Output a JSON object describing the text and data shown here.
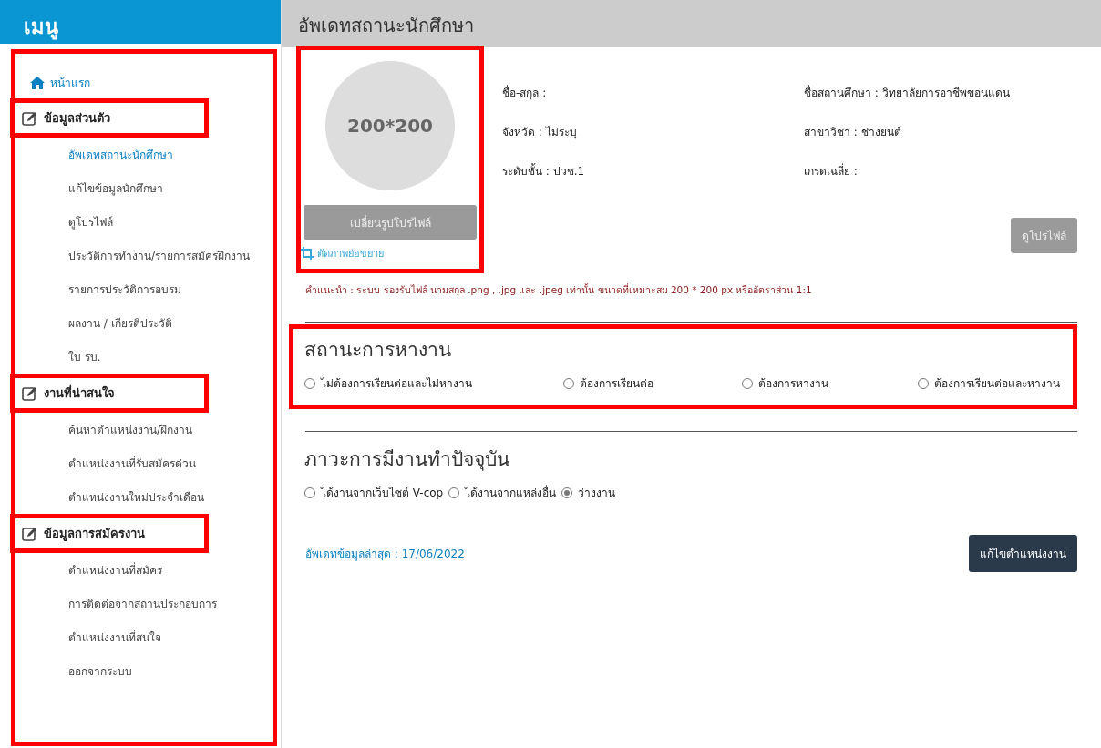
{
  "sidebar": {
    "title": "เมนู",
    "highlighted": true,
    "home": {
      "label": "หน้าแรก"
    },
    "sections": [
      {
        "heading": "ข้อมูลส่วนตัว",
        "highlighted": true,
        "items": [
          {
            "label": "อัพเดทสถานะนักศึกษา",
            "selected": true
          },
          {
            "label": "แก้ไขข้อมูลนักศึกษา",
            "selected": false
          },
          {
            "label": "ดูโปรไฟล์",
            "selected": false
          },
          {
            "label": "ประวัติการทำงาน/รายการสมัครฝึกงาน",
            "selected": false
          },
          {
            "label": "รายการประวัติการอบรม",
            "selected": false
          },
          {
            "label": "ผลงาน / เกียรติประวัติ",
            "selected": false
          },
          {
            "label": "ใบ รบ.",
            "selected": false
          }
        ]
      },
      {
        "heading": "งานที่น่าสนใจ",
        "highlighted": true,
        "items": [
          {
            "label": "ค้นหาตำแหน่งงาน/ฝึกงาน",
            "selected": false
          },
          {
            "label": "ตำแหน่งงานที่รับสมัครด่วน",
            "selected": false
          },
          {
            "label": "ตำแหน่งงานใหม่ประจำเดือน",
            "selected": false
          }
        ]
      },
      {
        "heading": "ข้อมูลการสมัครงาน",
        "highlighted": true,
        "items": [
          {
            "label": "ตำแหน่งงานที่สมัคร",
            "selected": false
          },
          {
            "label": "การติดต่อจากสถานประกอบการ",
            "selected": false
          },
          {
            "label": "ตำแหน่งงานที่สนใจ",
            "selected": false
          },
          {
            "label": "ออกจากระบบ",
            "selected": false
          }
        ]
      }
    ]
  },
  "page": {
    "title": "อัพเดทสถานะนักศึกษา"
  },
  "profile": {
    "highlighted": true,
    "photo_placeholder": "200*200",
    "change_photo_button": "เปลี่ยนรูปโปรไฟล์",
    "crop_link": "ตัดภาพย่อขยาย",
    "fields": [
      {
        "label": "ชื่อ-สกุล :"
      },
      {
        "label": "ชื่อสถานศึกษา :",
        "value": "วิทยาลัยการอาชีพขอนแดน"
      },
      {
        "label": "จังหวัด :",
        "value": "ไม่ระบุ"
      },
      {
        "label": "สาขาวิชา :",
        "value": "ช่างยนต์"
      },
      {
        "label": "ระดับชั้น :",
        "value": "ปวช.1"
      },
      {
        "label": "เกรดเฉลี่ย :"
      }
    ],
    "view_profile_button": "ดูโปรไฟล์",
    "hint": "คำแนะนำ : ระบบ รองรับไฟล์ นามสกุล .png , .jpg และ .jpeg เท่านั้น ขนาดที่เหมาะสม 200 * 200 px หรืออัตราส่วน 1:1"
  },
  "job_search_status": {
    "title": "สถานะการหางาน",
    "highlighted": true,
    "options": [
      {
        "label": "ไม่ต้องการเรียนต่อและไม่หางาน",
        "selected": false
      },
      {
        "label": "ต้องการเรียนต่อ",
        "selected": false
      },
      {
        "label": "ต้องการหางาน",
        "selected": false
      },
      {
        "label": "ต้องการเรียนต่อและหางาน",
        "selected": false
      }
    ]
  },
  "employment_status": {
    "title": "ภาวะการมีงานทำปัจจุบัน",
    "highlighted": false,
    "options": [
      {
        "label": "ได้งานจากเว็บไซต์ V-cop",
        "selected": false
      },
      {
        "label": "ได้งานจากแหล่งอื่น",
        "selected": false
      },
      {
        "label": "ว่างงาน",
        "selected": true
      }
    ]
  },
  "last_updated": "อัพเดทข้อมูลล่าสุด : 17/06/2022",
  "edit_position_button": "แก้ไขตำแหน่งงาน"
}
